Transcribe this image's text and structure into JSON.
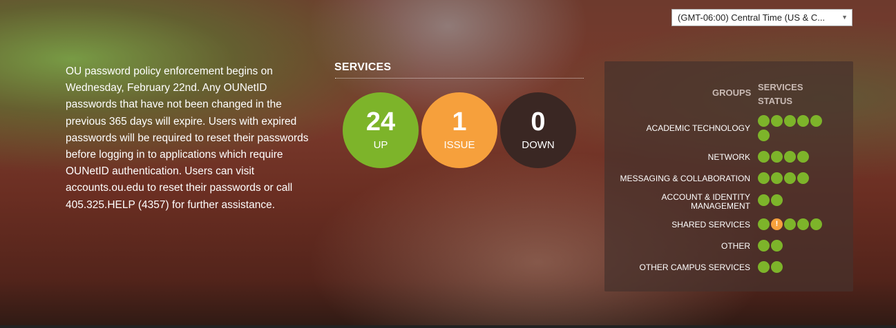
{
  "timezone": {
    "selected": "(GMT-06:00) Central Time (US & C..."
  },
  "announcement": "OU password policy enforcement begins on Wednesday, February 22nd. Any OUNetID passwords that have not been changed in the previous 365 days will expire. Users with expired passwords will be required to reset their passwords before logging in to applications which require OUNetID authentication. Users can visit accounts.ou.edu to reset their passwords or call 405.325.HELP (4357) for further assistance.",
  "services": {
    "title": "SERVICES",
    "up": {
      "count": "24",
      "label": "UP"
    },
    "issue": {
      "count": "1",
      "label": "ISSUE"
    },
    "down": {
      "count": "0",
      "label": "DOWN"
    }
  },
  "status_table": {
    "groups_header": "GROUPS",
    "status_header": "SERVICES STATUS",
    "groups": [
      {
        "name": "ACADEMIC TECHNOLOGY",
        "statuses": [
          "up",
          "up",
          "up",
          "up",
          "up",
          "up"
        ]
      },
      {
        "name": "NETWORK",
        "statuses": [
          "up",
          "up",
          "up",
          "up"
        ]
      },
      {
        "name": "MESSAGING & COLLABORATION",
        "statuses": [
          "up",
          "up",
          "up",
          "up"
        ]
      },
      {
        "name": "ACCOUNT & IDENTITY MANAGEMENT",
        "statuses": [
          "up",
          "up"
        ]
      },
      {
        "name": "SHARED SERVICES",
        "statuses": [
          "up",
          "issue",
          "up",
          "up",
          "up"
        ]
      },
      {
        "name": "OTHER",
        "statuses": [
          "up",
          "up"
        ]
      },
      {
        "name": "OTHER CAMPUS SERVICES",
        "statuses": [
          "up",
          "up"
        ]
      }
    ]
  },
  "colors": {
    "up": "#7db42a",
    "issue": "#f6a03c",
    "down": "#3a2723"
  }
}
